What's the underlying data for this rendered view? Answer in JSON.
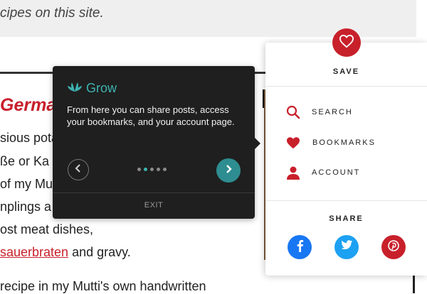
{
  "article": {
    "banner_text": "cipes on this site.",
    "heading": "Germa",
    "lines": [
      "sious pota",
      "ße or Ka",
      "of my Mu",
      "nplings a",
      "ost meat dishes,",
      "sauerbraten",
      " and gravy.",
      "recipe in my Mutti's own handwritten"
    ]
  },
  "tooltip": {
    "brand": "Grow",
    "body": "From here you can share posts, access your bookmarks, and your account page.",
    "dots_total": 5,
    "active_dot": 1,
    "exit_label": "EXIT"
  },
  "panel": {
    "save_label": "SAVE",
    "menu": [
      {
        "label": "SEARCH",
        "icon": "search-icon"
      },
      {
        "label": "BOOKMARKS",
        "icon": "heart-icon"
      },
      {
        "label": "ACCOUNT",
        "icon": "user-icon"
      }
    ],
    "share_label": "SHARE",
    "social": [
      {
        "name": "facebook",
        "color": "#1877f2"
      },
      {
        "name": "twitter",
        "color": "#1da1f2"
      },
      {
        "name": "pinterest",
        "color": "#c8202b"
      }
    ]
  },
  "colors": {
    "accent_red": "#c8202b",
    "teal": "#3db2b0",
    "teal_button": "#2e8d90"
  }
}
